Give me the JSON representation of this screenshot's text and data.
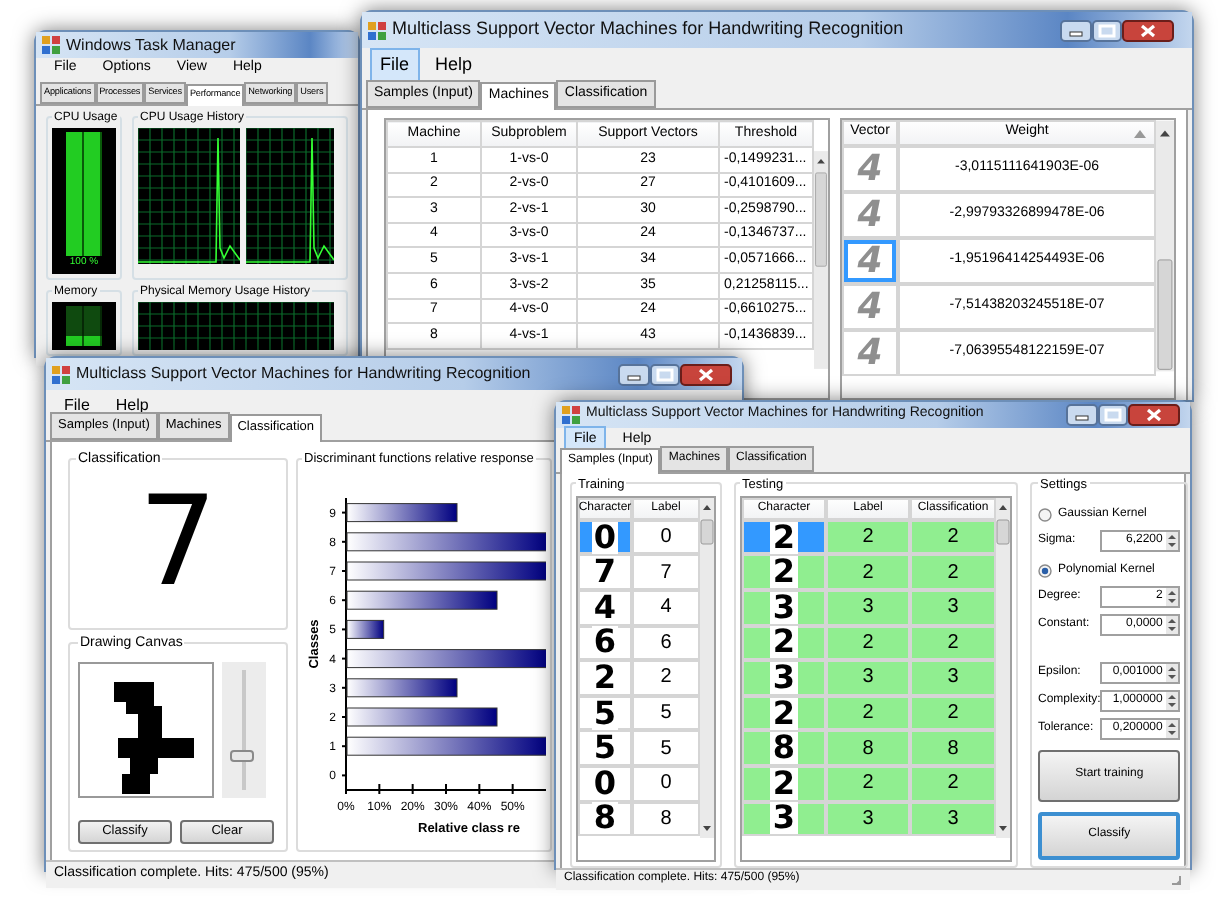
{
  "task_manager": {
    "title": "Windows Task Manager",
    "menu": [
      {
        "label": "File",
        "highlighted": false
      },
      {
        "label": "Options",
        "highlighted": false
      },
      {
        "label": "View",
        "highlighted": false
      },
      {
        "label": "Help",
        "highlighted": false
      }
    ],
    "tabs": [
      {
        "label": "Applications",
        "selected": false
      },
      {
        "label": "Processes",
        "selected": false
      },
      {
        "label": "Services",
        "selected": false
      },
      {
        "label": "Performance",
        "selected": true
      },
      {
        "label": "Networking",
        "selected": false
      },
      {
        "label": "Users",
        "selected": false
      }
    ],
    "cpu_usage": {
      "title": "CPU Usage",
      "reading": "100 %",
      "level": 1
    },
    "cpu_history": {
      "title": "CPU Usage History"
    },
    "memory": {
      "title": "Memory",
      "level": 0.25
    },
    "memory_history": {
      "title": "Physical Memory Usage History"
    }
  },
  "machines_window": {
    "title": "Multiclass Support Vector Machines for Handwriting Recognition",
    "menu": [
      {
        "label": "File",
        "highlighted": true
      },
      {
        "label": "Help",
        "highlighted": false
      }
    ],
    "tabs": [
      {
        "label": "Samples (Input)",
        "selected": false
      },
      {
        "label": "Machines",
        "selected": true
      },
      {
        "label": "Classification",
        "selected": false
      }
    ],
    "machines_table": {
      "columns": [
        "Machine",
        "Subproblem",
        "Support Vectors",
        "Threshold"
      ],
      "rows": [
        [
          "1",
          "1-vs-0",
          "23",
          "-0,1499231..."
        ],
        [
          "2",
          "2-vs-0",
          "27",
          "-0,4101609..."
        ],
        [
          "3",
          "2-vs-1",
          "30",
          "-0,2598790..."
        ],
        [
          "4",
          "3-vs-0",
          "24",
          "-0,1346737..."
        ],
        [
          "5",
          "3-vs-1",
          "34",
          "-0,0571666..."
        ],
        [
          "6",
          "3-vs-2",
          "35",
          "0,21258115..."
        ],
        [
          "7",
          "4-vs-0",
          "24",
          "-0,6610275..."
        ],
        [
          "8",
          "4-vs-1",
          "43",
          "-0,1436839..."
        ]
      ]
    },
    "weights_table": {
      "columns": [
        "Vector",
        "Weight"
      ],
      "rows": [
        {
          "vector": "4",
          "weight": "-3,0115111641903E-06",
          "selected": false
        },
        {
          "vector": "4",
          "weight": "-2,99793326899478E-06",
          "selected": false
        },
        {
          "vector": "4",
          "weight": "-1,95196414254493E-06",
          "selected": true
        },
        {
          "vector": "4",
          "weight": "-7,51438203245518E-07",
          "selected": false
        },
        {
          "vector": "4",
          "weight": "-7,06395548122159E-07",
          "selected": false
        }
      ]
    }
  },
  "classification_window": {
    "title": "Multiclass Support Vector Machines for Handwriting Recognition",
    "menu": [
      {
        "label": "File",
        "highlighted": false
      },
      {
        "label": "Help",
        "highlighted": false
      }
    ],
    "tabs": [
      {
        "label": "Samples (Input)",
        "selected": false
      },
      {
        "label": "Machines",
        "selected": false
      },
      {
        "label": "Classification",
        "selected": true
      }
    ],
    "classification": {
      "title": "Classification",
      "result": "7"
    },
    "drawing_canvas": {
      "title": "Drawing Canvas",
      "level": 0.25
    },
    "buttons": [
      "Classify",
      "Clear"
    ],
    "chart": {
      "title": "Discriminant functions relative response",
      "chart_data": {
        "type": "bar",
        "orientation": "horizontal",
        "ylabel": "Classes",
        "xlabel": "Relative class re",
        "categories": [
          "9",
          "8",
          "7",
          "6",
          "5",
          "4",
          "3",
          "2",
          "1",
          "0"
        ],
        "values": [
          33,
          60,
          60,
          45,
          11,
          60,
          33,
          45,
          60,
          0
        ],
        "xlim": [
          0,
          60
        ],
        "xticks": [
          {
            "value": 0,
            "label": "0%"
          },
          {
            "value": 10,
            "label": "10%"
          },
          {
            "value": 20,
            "label": "20%"
          },
          {
            "value": 30,
            "label": "30%"
          },
          {
            "value": 40,
            "label": "40%"
          },
          {
            "value": 50,
            "label": "50%"
          }
        ]
      }
    },
    "status_bar": "Classification complete. Hits: 475/500 (95%)"
  },
  "samples_window": {
    "title": "Multiclass Support Vector Machines for Handwriting Recognition",
    "menu": [
      {
        "label": "File",
        "highlighted": true
      },
      {
        "label": "Help",
        "highlighted": false
      }
    ],
    "tabs": [
      {
        "label": "Samples (Input)",
        "selected": true
      },
      {
        "label": "Machines",
        "selected": false
      },
      {
        "label": "Classification",
        "selected": false
      }
    ],
    "training": {
      "title": "Training",
      "columns": [
        "Character",
        "Label"
      ],
      "rows": [
        {
          "character": "0",
          "label": "0",
          "selected": true
        },
        {
          "character": "7",
          "label": "7",
          "selected": false
        },
        {
          "character": "4",
          "label": "4",
          "selected": false
        },
        {
          "character": "6",
          "label": "6",
          "selected": false
        },
        {
          "character": "2",
          "label": "2",
          "selected": false
        },
        {
          "character": "5",
          "label": "5",
          "selected": false
        },
        {
          "character": "5",
          "label": "5",
          "selected": false
        },
        {
          "character": "0",
          "label": "0",
          "selected": false
        },
        {
          "character": "8",
          "label": "8",
          "selected": false
        }
      ]
    },
    "testing": {
      "title": "Testing",
      "columns": [
        "Character",
        "Label",
        "Classification"
      ],
      "rows": [
        {
          "character": "2",
          "label": "2",
          "classification": "2",
          "selected": true,
          "correct": true
        },
        {
          "character": "2",
          "label": "2",
          "classification": "2",
          "selected": false,
          "correct": true
        },
        {
          "character": "3",
          "label": "3",
          "classification": "3",
          "selected": false,
          "correct": true
        },
        {
          "character": "2",
          "label": "2",
          "classification": "2",
          "selected": false,
          "correct": true
        },
        {
          "character": "3",
          "label": "3",
          "classification": "3",
          "selected": false,
          "correct": true
        },
        {
          "character": "2",
          "label": "2",
          "classification": "2",
          "selected": false,
          "correct": true
        },
        {
          "character": "8",
          "label": "8",
          "classification": "8",
          "selected": false,
          "correct": true
        },
        {
          "character": "2",
          "label": "2",
          "classification": "2",
          "selected": false,
          "correct": true
        },
        {
          "character": "3",
          "label": "3",
          "classification": "3",
          "selected": false,
          "correct": true
        }
      ]
    },
    "settings": {
      "title": "Settings",
      "kernels": [
        {
          "label": "Gaussian Kernel",
          "selected": false,
          "fields": [
            {
              "label": "Sigma:",
              "value": "6,2200"
            }
          ]
        },
        {
          "label": "Polynomial Kernel",
          "selected": true,
          "fields": [
            {
              "label": "Degree:",
              "value": "2"
            },
            {
              "label": "Constant:",
              "value": "0,0000"
            }
          ]
        }
      ],
      "parameters": [
        {
          "label": "Epsilon:",
          "value": "0,001000"
        },
        {
          "label": "Complexity:",
          "value": "1,000000"
        },
        {
          "label": "Tolerance:",
          "value": "0,200000"
        }
      ],
      "buttons": [
        {
          "label": "Start training",
          "focused": false
        },
        {
          "label": "Classify",
          "focused": true
        }
      ]
    },
    "status_bar": "Classification complete. Hits: 475/500 (95%)"
  }
}
